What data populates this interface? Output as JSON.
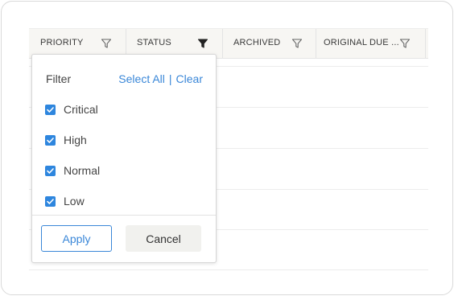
{
  "columns": [
    {
      "label": "PRIORITY",
      "filter_active": false,
      "icon": "filter-icon"
    },
    {
      "label": "STATUS",
      "filter_active": true,
      "icon": "filter-filled-icon"
    },
    {
      "label": "ARCHIVED",
      "filter_active": false,
      "icon": "filter-icon"
    },
    {
      "label": "ORIGINAL DUE ...",
      "filter_active": false,
      "icon": "filter-icon"
    }
  ],
  "filter_popup": {
    "title": "Filter",
    "select_all": "Select All",
    "separator": "|",
    "clear": "Clear",
    "options": [
      {
        "label": "Critical",
        "checked": true
      },
      {
        "label": "High",
        "checked": true
      },
      {
        "label": "Normal",
        "checked": true
      },
      {
        "label": "Low",
        "checked": true
      }
    ],
    "apply": "Apply",
    "cancel": "Cancel"
  },
  "colors": {
    "accent": "#3a87d8",
    "checkbox": "#2e86de",
    "header_bg": "#f7f6f3"
  }
}
